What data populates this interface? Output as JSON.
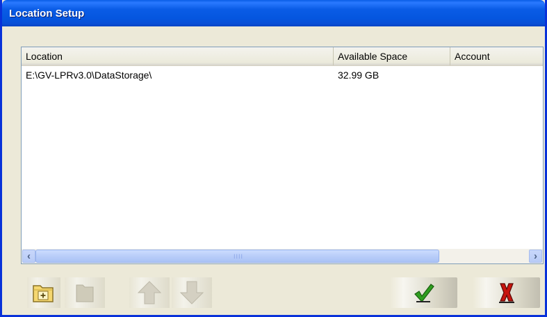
{
  "window": {
    "title": "Location Setup"
  },
  "list": {
    "columns": [
      "Location",
      "Available Space",
      "Account"
    ],
    "rows": [
      {
        "location": "E:\\GV-LPRv3.0\\DataStorage\\",
        "available_space": "32.99 GB",
        "account": ""
      }
    ]
  },
  "scrollbar": {
    "left_arrow": "‹",
    "right_arrow": "›",
    "grip": "IIII"
  },
  "toolbar": {
    "icons": [
      "add-folder-icon",
      "remove-folder-icon",
      "move-up-icon",
      "move-down-icon",
      "ok-checkmark-icon",
      "cancel-x-icon"
    ]
  },
  "colors": {
    "titlebar": "#0a5ce6",
    "window_border": "#0831d9",
    "background": "#ece9d8",
    "ok_green": "#2f9e1f",
    "cancel_red": "#c8140d"
  }
}
